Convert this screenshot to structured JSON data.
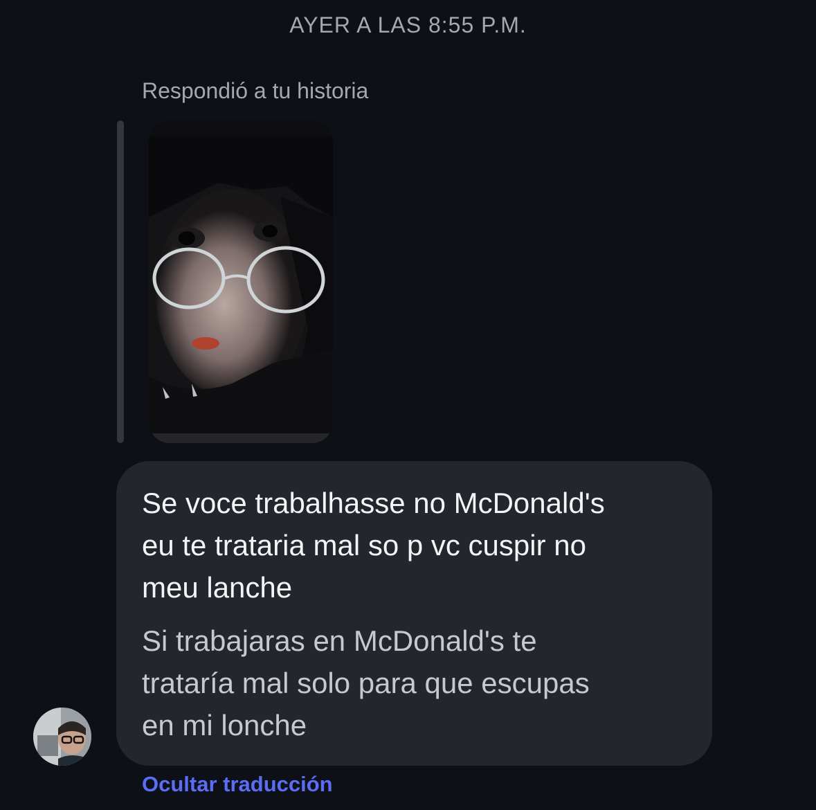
{
  "conversation": {
    "timestamp": "AYER A LAS 8:55 P.M.",
    "story_reply": {
      "label": "Respondió a tu historia",
      "thumbnail": "story-photo"
    },
    "message": {
      "original_lines": "Se voce trabalhasse no McDonald's\neu te trataria mal so p vc cuspir no\nmeu lanche",
      "translation_lines": "Si trabajaras en McDonald's te\ntrataría mal solo para que escupas\nen mi lonche"
    },
    "sender_avatar": "profile-photo",
    "translation_toggle_label": "Ocultar traducción"
  },
  "colors": {
    "background": "#0d1016",
    "bubble": "#23262c",
    "link": "#5b6cf5",
    "muted_text": "#a4a8b0"
  }
}
